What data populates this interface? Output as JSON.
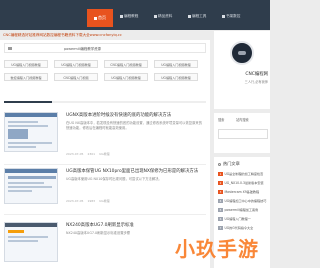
{
  "nav": {
    "items": [
      {
        "label": "首页",
        "icon": "home-icon"
      },
      {
        "label": "编程教程",
        "icon": "book-icon"
      },
      {
        "label": "精品资料",
        "icon": "doc-icon"
      },
      {
        "label": "编程工具",
        "icon": "tool-icon"
      },
      {
        "label": "书架数控",
        "icon": "shelf-icon"
      }
    ]
  },
  "banner": "CNC编程精选好站推荐网站数控编程书籍资料下载大全www.cncfanyiq.cc",
  "notice": "powermill编程教学资源",
  "tags": [
    "UG编程入门视频教程",
    "UG编程入门视频教程",
    "CNC编程入门视频教程",
    "UG编程入门视频教程",
    "数控编程入门视频教程",
    "CNC编程入门视频",
    "UG编程入门视频教程",
    "UG编程入门视频教程"
  ],
  "progress": 0.24,
  "articles": [
    {
      "title": "UGNX高版本进阶时候没有快速的底的功能的解决方法",
      "summary": "在UG NX高版本中，若发现没有快速的底的功能设置，通过修改系统环境变量可以恢复原来的快速功能，修改后在编程时就能高效使用。",
      "date": "2023-07-05",
      "views": "2301",
      "category": "UG教程"
    },
    {
      "title": "UG高版本保管UG NX10pro里面已出现NX保修为已形是的解决方法",
      "summary": "UG高版本使用UG NX10保存时出现问题，可尝试以下方法解决。",
      "date": "2023-07-05",
      "views": "1983",
      "category": "UG教程"
    },
    {
      "title": "NX240高版本UG7.0刷新显示标准",
      "summary": "NX240高版本UG7.0刷新显示标准设置步骤",
      "date": "2023-07-05",
      "views": "1520",
      "category": "UG教程"
    }
  ],
  "profile": {
    "name": "CNC编程网",
    "desc": "三人行,必有我师"
  },
  "search": {
    "tabs": [
      "搜索",
      "站内搜索"
    ]
  },
  "latest": {
    "title": "热门文章",
    "items": [
      "UG是全制程的加工精度检查",
      "UG_NX10.0.3最新版本安装",
      "Mastercam X9基础教程",
      "UG编程加工中心中的编程技巧",
      "powermill编程加工案例",
      "UG编程入门教程一",
      "UG的G代码指令大全"
    ],
    "badge_colors": [
      "#e8531e",
      "#e8531e",
      "#e8531e",
      "#9ca3af",
      "#9ca3af",
      "#9ca3af",
      "#9ca3af"
    ]
  },
  "watermark": "小玖手游"
}
